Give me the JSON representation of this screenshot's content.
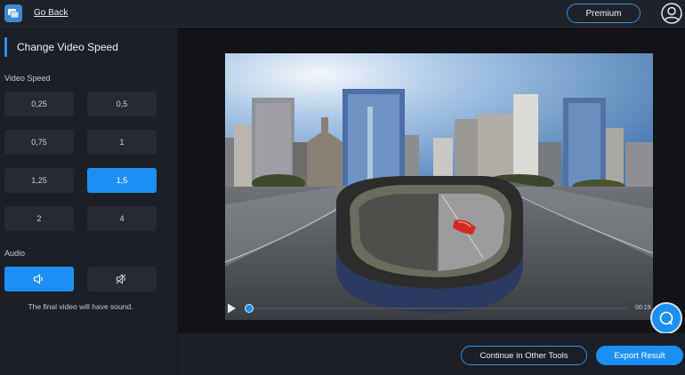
{
  "header": {
    "go_back_label": "Go Back",
    "premium_label": "Premium"
  },
  "sidebar": {
    "title": "Change Video Speed",
    "video_speed_label": "Video Speed",
    "speeds": [
      "0,25",
      "0,5",
      "0,75",
      "1",
      "1,25",
      "1,5",
      "2",
      "4"
    ],
    "selected_speed": "1,5",
    "audio_label": "Audio",
    "audio_selected": "sound-on",
    "audio_note": "The final video will have sound."
  },
  "player": {
    "time_label": "00:19",
    "progress": 0.0
  },
  "footer": {
    "continue_label": "Continue in Other Tools",
    "export_label": "Export Result"
  },
  "colors": {
    "accent": "#1e8ff2",
    "background": "#15171c",
    "panel": "#1c1f25",
    "button": "#262a31"
  },
  "icons": {
    "logo": "app-logo-icon",
    "avatar": "user-avatar-icon",
    "sound_on": "speaker-icon",
    "sound_off": "speaker-muted-icon",
    "play": "play-icon",
    "help": "chat-help-icon"
  }
}
